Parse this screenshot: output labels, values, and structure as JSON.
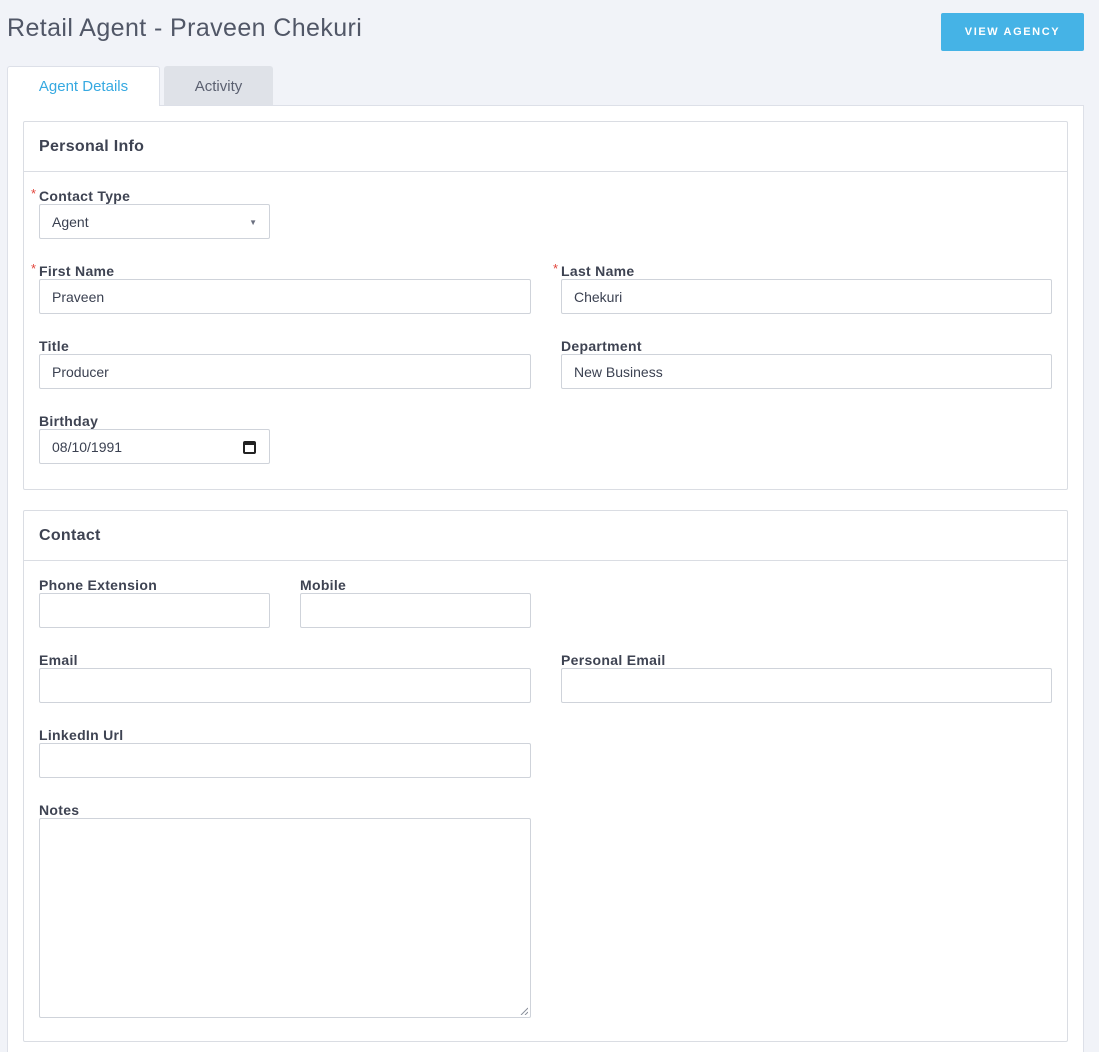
{
  "header": {
    "title": "Retail Agent - Praveen Chekuri",
    "view_agency_label": "VIEW AGENCY"
  },
  "tabs": [
    {
      "label": "Agent Details",
      "active": true
    },
    {
      "label": "Activity",
      "active": false
    }
  ],
  "personal_info": {
    "heading": "Personal Info",
    "contact_type": {
      "label": "Contact Type",
      "value": "Agent",
      "required": true
    },
    "first_name": {
      "label": "First Name",
      "value": "Praveen",
      "required": true
    },
    "last_name": {
      "label": "Last Name",
      "value": "Chekuri",
      "required": true
    },
    "title": {
      "label": "Title",
      "value": "Producer"
    },
    "department": {
      "label": "Department",
      "value": "New Business"
    },
    "birthday": {
      "label": "Birthday",
      "value": "08/10/1991"
    }
  },
  "contact": {
    "heading": "Contact",
    "phone_extension": {
      "label": "Phone Extension",
      "value": ""
    },
    "mobile": {
      "label": "Mobile",
      "value": ""
    },
    "email": {
      "label": "Email",
      "value": ""
    },
    "personal_email": {
      "label": "Personal Email",
      "value": ""
    },
    "linkedin_url": {
      "label": "LinkedIn Url",
      "value": ""
    },
    "notes": {
      "label": "Notes",
      "value": ""
    }
  },
  "required_marker": "*",
  "colors": {
    "accent": "#45b3e6",
    "active_tab_text": "#36a9e1",
    "required": "#e2453c",
    "background": "#f1f3f8"
  }
}
